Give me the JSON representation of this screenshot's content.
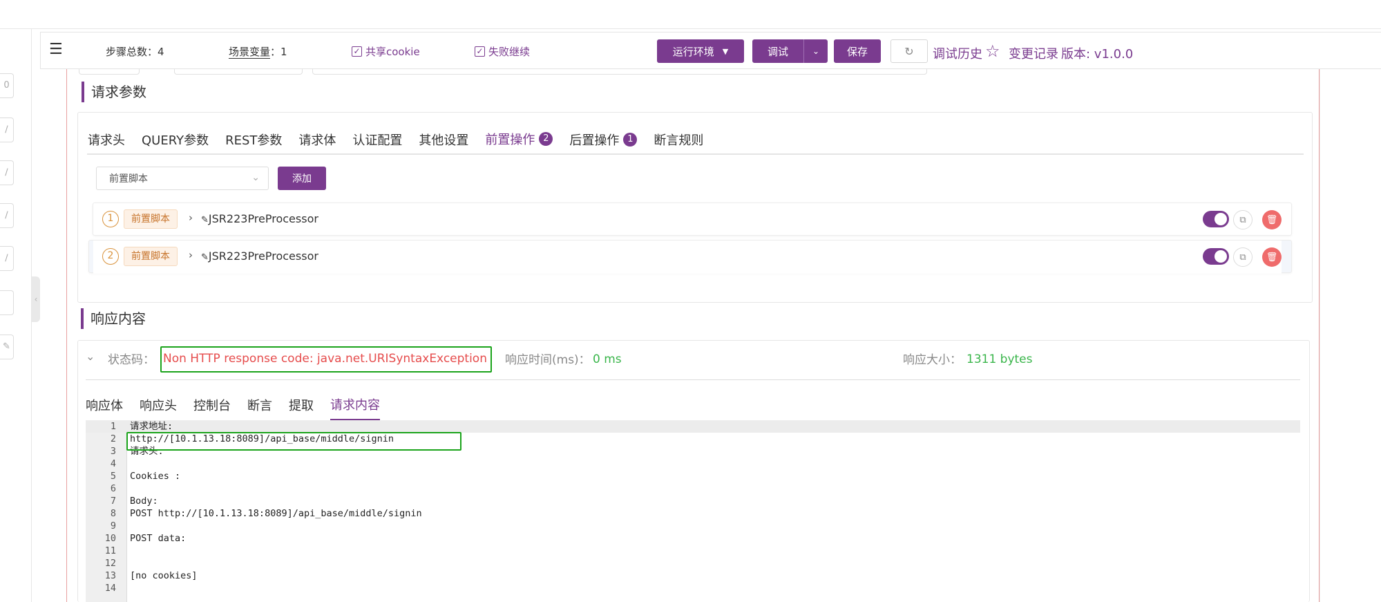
{
  "header": {
    "steps_label": "步骤总数：",
    "steps_value": "4",
    "scene_var_label": "场景变量",
    "scene_var_sep": "：",
    "scene_var_value": "1",
    "share_cookie_label": "共享cookie",
    "fail_inherit_label": "失败继续",
    "env_button": "运行环境",
    "debug_button": "调试",
    "save_button": "保存",
    "debug_history": "调试历史",
    "change_log": "变更记录",
    "version": "版本: v1.0.0"
  },
  "request_params": {
    "title": "请求参数",
    "tabs": [
      {
        "label": "请求头"
      },
      {
        "label": "QUERY参数"
      },
      {
        "label": "REST参数"
      },
      {
        "label": "请求体"
      },
      {
        "label": "认证配置"
      },
      {
        "label": "其他设置"
      },
      {
        "label": "前置操作",
        "badge": "2"
      },
      {
        "label": "后置操作",
        "badge": "1"
      },
      {
        "label": "断言规则"
      }
    ],
    "select_value": "前置脚本",
    "add_button": "添加",
    "processors": [
      {
        "index": "1",
        "tag": "前置脚本",
        "name": "JSR223PreProcessor"
      },
      {
        "index": "2",
        "tag": "前置脚本",
        "name": "JSR223PreProcessor"
      }
    ]
  },
  "response": {
    "title": "响应内容",
    "status_label": "状态码：",
    "status_value": "Non HTTP response code: java.net.URISyntaxException",
    "time_label": "响应时间(ms)：",
    "time_value": "0 ms",
    "size_label": "响应大小：",
    "size_value": "1311 bytes",
    "tabs": [
      {
        "label": "响应体"
      },
      {
        "label": "响应头"
      },
      {
        "label": "控制台"
      },
      {
        "label": "断言"
      },
      {
        "label": "提取"
      },
      {
        "label": "请求内容"
      }
    ],
    "code_lines": [
      {
        "n": "1",
        "text": "请求地址:"
      },
      {
        "n": "2",
        "text": "http://[10.1.13.18:8089]/api_base/middle/signin"
      },
      {
        "n": "3",
        "text": "请求头:"
      },
      {
        "n": "4",
        "text": ""
      },
      {
        "n": "5",
        "text": "Cookies :"
      },
      {
        "n": "6",
        "text": ""
      },
      {
        "n": "7",
        "text": "Body:"
      },
      {
        "n": "8",
        "text": "POST http://[10.1.13.18:8089]/api_base/middle/signin"
      },
      {
        "n": "9",
        "text": ""
      },
      {
        "n": "10",
        "text": "POST data:"
      },
      {
        "n": "11",
        "text": ""
      },
      {
        "n": "12",
        "text": ""
      },
      {
        "n": "13",
        "text": "[no cookies]"
      },
      {
        "n": "14",
        "text": ""
      }
    ]
  },
  "left_strip": {
    "first_box_text": "0"
  },
  "colors": {
    "primary": "#7a3b8f",
    "error": "#e64c4c",
    "success": "#39b54a",
    "highlight_box": "#1aa31a",
    "tag_orange": "#c7742c"
  }
}
